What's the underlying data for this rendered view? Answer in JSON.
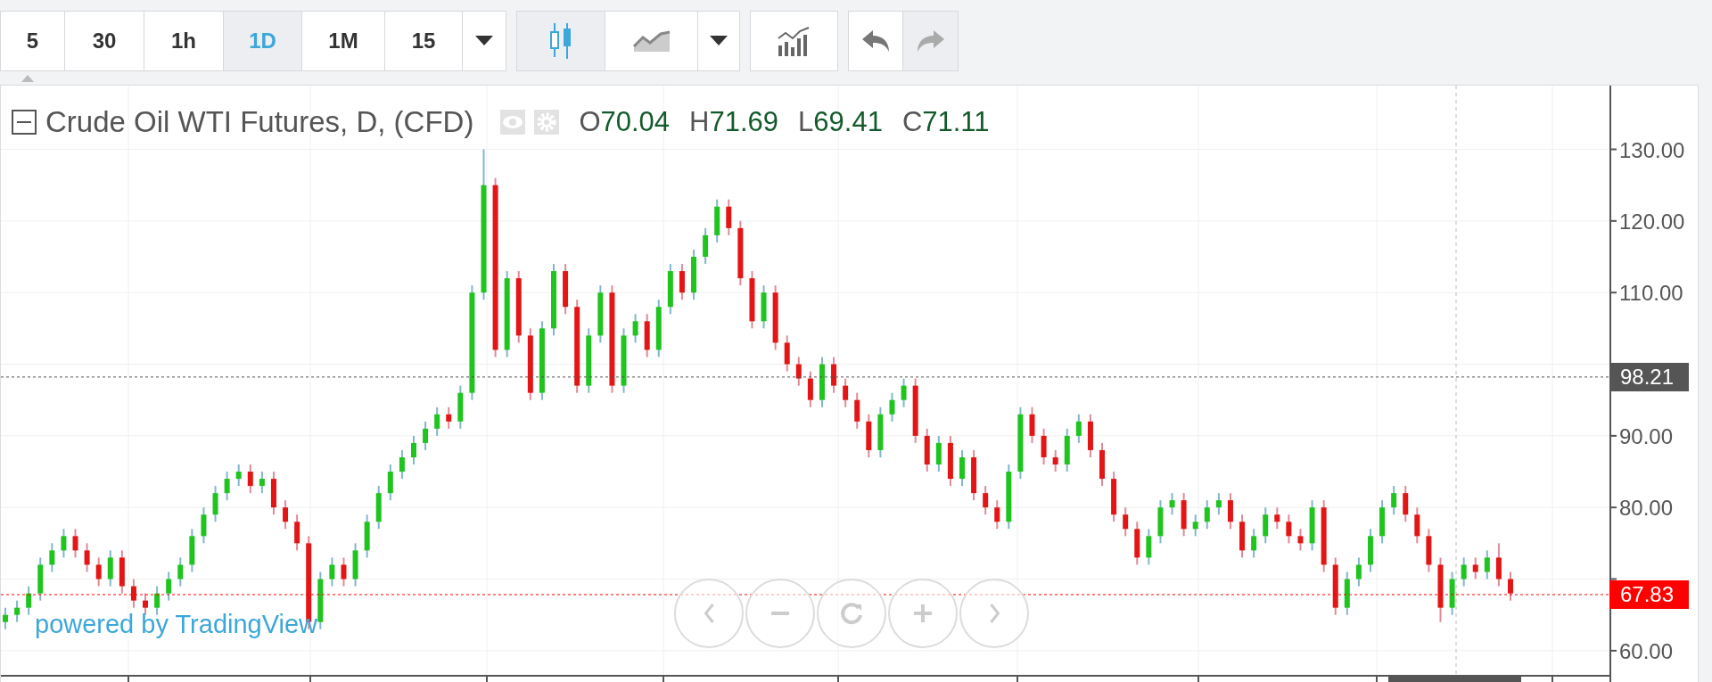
{
  "toolbar": {
    "intervals": [
      {
        "label": "5",
        "selected": false
      },
      {
        "label": "30",
        "selected": false
      },
      {
        "label": "1h",
        "selected": false
      },
      {
        "label": "1D",
        "selected": true
      },
      {
        "label": "1M",
        "selected": false
      },
      {
        "label": "15",
        "selected": false
      }
    ],
    "chart_styles": [
      {
        "kind": "candles",
        "selected": true
      },
      {
        "kind": "area",
        "selected": false
      }
    ],
    "history": [
      {
        "kind": "undo",
        "disabled": false
      },
      {
        "kind": "redo",
        "disabled": true
      }
    ]
  },
  "legend": {
    "ohlc": [
      {
        "label": "O",
        "value": "70.04"
      },
      {
        "label": "H",
        "value": "71.69"
      },
      {
        "label": "L",
        "value": "69.41"
      },
      {
        "label": "C",
        "value": "71.11"
      }
    ]
  },
  "chart": {
    "chart_data": {
      "type": "candlestick",
      "title": "Crude Oil WTI Futures, D, (CFD)",
      "grid": true,
      "ylim": [
        56.5,
        138.9
      ],
      "yticks": [
        {
          "value": 60,
          "label": "60.00"
        },
        {
          "value": 80,
          "label": "80.00"
        },
        {
          "value": 90,
          "label": "90.00"
        },
        {
          "value": 110,
          "label": "110.00"
        },
        {
          "value": 120,
          "label": "120.00"
        },
        {
          "value": 130,
          "label": "130.00"
        }
      ],
      "ohlc": [
        [
          64,
          66,
          63,
          65
        ],
        [
          65,
          67,
          64,
          66
        ],
        [
          66,
          69,
          65,
          68
        ],
        [
          68,
          73,
          67,
          72
        ],
        [
          72,
          75,
          71,
          74
        ],
        [
          74,
          77,
          73,
          76
        ],
        [
          76,
          77,
          73,
          74
        ],
        [
          74,
          75,
          71,
          72
        ],
        [
          72,
          73,
          69,
          70
        ],
        [
          70,
          74,
          69,
          73
        ],
        [
          73,
          74,
          68,
          69
        ],
        [
          69,
          70,
          66,
          67
        ],
        [
          67,
          68,
          65,
          66
        ],
        [
          66,
          69,
          65,
          68
        ],
        [
          68,
          71,
          67,
          70
        ],
        [
          70,
          73,
          69,
          72
        ],
        [
          72,
          77,
          71,
          76
        ],
        [
          76,
          80,
          75,
          79
        ],
        [
          79,
          83,
          78,
          82
        ],
        [
          82,
          85,
          81,
          84
        ],
        [
          84,
          86,
          83,
          85
        ],
        [
          85,
          86,
          82,
          83
        ],
        [
          83,
          85,
          82,
          84
        ],
        [
          84,
          85,
          79,
          80
        ],
        [
          80,
          81,
          77,
          78
        ],
        [
          78,
          79,
          74,
          75
        ],
        [
          75,
          76,
          63,
          64
        ],
        [
          64,
          71,
          63,
          70
        ],
        [
          70,
          73,
          69,
          72
        ],
        [
          72,
          73,
          69,
          70
        ],
        [
          70,
          75,
          69,
          74
        ],
        [
          74,
          79,
          73,
          78
        ],
        [
          78,
          83,
          77,
          82
        ],
        [
          82,
          86,
          81,
          85
        ],
        [
          85,
          88,
          84,
          87
        ],
        [
          87,
          90,
          86,
          89
        ],
        [
          89,
          92,
          88,
          91
        ],
        [
          91,
          94,
          90,
          93
        ],
        [
          93,
          94,
          91,
          92
        ],
        [
          92,
          97,
          91,
          96
        ],
        [
          96,
          111,
          95,
          110
        ],
        [
          110,
          130,
          109,
          125
        ],
        [
          125,
          126,
          101,
          102
        ],
        [
          102,
          113,
          101,
          112
        ],
        [
          112,
          113,
          103,
          104
        ],
        [
          104,
          105,
          95,
          96
        ],
        [
          96,
          106,
          95,
          105
        ],
        [
          105,
          114,
          104,
          113
        ],
        [
          113,
          114,
          107,
          108
        ],
        [
          108,
          109,
          96,
          97
        ],
        [
          97,
          105,
          96,
          104
        ],
        [
          104,
          111,
          103,
          110
        ],
        [
          110,
          111,
          96,
          97
        ],
        [
          97,
          105,
          96,
          104
        ],
        [
          104,
          107,
          103,
          106
        ],
        [
          106,
          107,
          101,
          102
        ],
        [
          102,
          109,
          101,
          108
        ],
        [
          108,
          114,
          107,
          113
        ],
        [
          113,
          114,
          109,
          110
        ],
        [
          110,
          116,
          109,
          115
        ],
        [
          115,
          119,
          114,
          118
        ],
        [
          118,
          123,
          117,
          122
        ],
        [
          122,
          123,
          118,
          119
        ],
        [
          119,
          120,
          111,
          112
        ],
        [
          112,
          113,
          105,
          106
        ],
        [
          106,
          111,
          105,
          110
        ],
        [
          110,
          111,
          102,
          103
        ],
        [
          103,
          104,
          99,
          100
        ],
        [
          100,
          101,
          97,
          98
        ],
        [
          98,
          99,
          94,
          95
        ],
        [
          95,
          101,
          94,
          100
        ],
        [
          100,
          101,
          96,
          97
        ],
        [
          97,
          98,
          94,
          95
        ],
        [
          95,
          96,
          91,
          92
        ],
        [
          92,
          93,
          87,
          88
        ],
        [
          88,
          94,
          87,
          93
        ],
        [
          93,
          96,
          92,
          95
        ],
        [
          95,
          98,
          94,
          97
        ],
        [
          97,
          98,
          89,
          90
        ],
        [
          90,
          91,
          85,
          86
        ],
        [
          86,
          90,
          85,
          89
        ],
        [
          89,
          90,
          83,
          84
        ],
        [
          84,
          88,
          83,
          87
        ],
        [
          87,
          88,
          81,
          82
        ],
        [
          82,
          83,
          79,
          80
        ],
        [
          80,
          81,
          77,
          78
        ],
        [
          78,
          86,
          77,
          85
        ],
        [
          85,
          94,
          84,
          93
        ],
        [
          93,
          94,
          89,
          90
        ],
        [
          90,
          91,
          86,
          87
        ],
        [
          87,
          88,
          85,
          86
        ],
        [
          86,
          91,
          85,
          90
        ],
        [
          90,
          93,
          89,
          92
        ],
        [
          92,
          93,
          87,
          88
        ],
        [
          88,
          89,
          83,
          84
        ],
        [
          84,
          85,
          78,
          79
        ],
        [
          79,
          80,
          76,
          77
        ],
        [
          77,
          78,
          72,
          73
        ],
        [
          73,
          77,
          72,
          76
        ],
        [
          76,
          81,
          75,
          80
        ],
        [
          80,
          82,
          79,
          81
        ],
        [
          81,
          82,
          76,
          77
        ],
        [
          77,
          79,
          76,
          78
        ],
        [
          78,
          81,
          77,
          80
        ],
        [
          80,
          82,
          79,
          81
        ],
        [
          81,
          82,
          77,
          78
        ],
        [
          78,
          79,
          73,
          74
        ],
        [
          74,
          77,
          73,
          76
        ],
        [
          76,
          80,
          75,
          79
        ],
        [
          79,
          80,
          77,
          78
        ],
        [
          78,
          79,
          75,
          76
        ],
        [
          76,
          77,
          74,
          75
        ],
        [
          75,
          81,
          74,
          80
        ],
        [
          80,
          81,
          71,
          72
        ],
        [
          72,
          73,
          65,
          66
        ],
        [
          66,
          71,
          65,
          70
        ],
        [
          70,
          73,
          69,
          72
        ],
        [
          72,
          77,
          71,
          76
        ],
        [
          76,
          81,
          75,
          80
        ],
        [
          80,
          83,
          79,
          82
        ],
        [
          82,
          83,
          78,
          79
        ],
        [
          79,
          80,
          75,
          76
        ],
        [
          76,
          77,
          71,
          72
        ],
        [
          72,
          73,
          64,
          66
        ],
        [
          66,
          71,
          65,
          70
        ],
        [
          70,
          73,
          69,
          72
        ],
        [
          72,
          73,
          70,
          71
        ],
        [
          71,
          74,
          70,
          73
        ],
        [
          73,
          75,
          69,
          70
        ],
        [
          70,
          71,
          67,
          68
        ]
      ],
      "ref_lines": [
        {
          "axis": "y",
          "value": 98.21,
          "label": "98.21",
          "color": "#555555"
        },
        {
          "axis": "y",
          "value": 67.83,
          "label": "67.83",
          "color": "#ff0000"
        }
      ]
    }
  },
  "attribution": "powered by TradingView"
}
